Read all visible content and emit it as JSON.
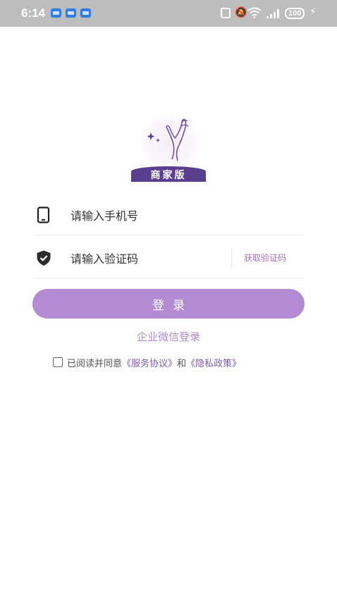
{
  "status_bar": {
    "time": "6:14",
    "battery": "100"
  },
  "logo": {
    "banner_text": "商家版"
  },
  "phone_field": {
    "placeholder": "请输入手机号",
    "icon": "phone-icon"
  },
  "code_field": {
    "placeholder": "请输入验证码",
    "icon": "shield-check-icon",
    "get_code_label": "获取验证码"
  },
  "login_button": {
    "label": "登录"
  },
  "wecom_login": {
    "label": "企业微信登录"
  },
  "agreement": {
    "prefix": "已阅读并同意",
    "service_link": "《服务协议》",
    "conjunction": "和",
    "privacy_link": "《隐私政策》",
    "checked": false
  },
  "colors": {
    "accent": "#b28bd2",
    "link": "#7a5aa8",
    "logo_banner": "#5a3e8f",
    "status_bar": "#bdbdbd"
  }
}
